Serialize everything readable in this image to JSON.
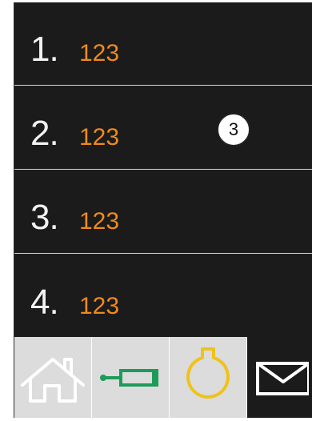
{
  "list": {
    "items": [
      {
        "index": "1.",
        "value": "123"
      },
      {
        "index": "2.",
        "value": "123"
      },
      {
        "index": "3.",
        "value": "123"
      },
      {
        "index": "4.",
        "value": "123"
      }
    ]
  },
  "badge": {
    "label": "3"
  },
  "colors": {
    "screen_bg": "#1b1b1b",
    "index_text": "#f3f3f3",
    "value_text": "#f08a1c",
    "nav_bg": "#dcdcdc",
    "cylinder_icon": "#1e9b5a",
    "tank_icon": "#f0c21a"
  },
  "bottom_nav": {
    "items": [
      {
        "icon": "home-icon"
      },
      {
        "icon": "hydraulic-cylinder-icon"
      },
      {
        "icon": "tank-icon"
      },
      {
        "icon": "mail-icon"
      }
    ]
  }
}
